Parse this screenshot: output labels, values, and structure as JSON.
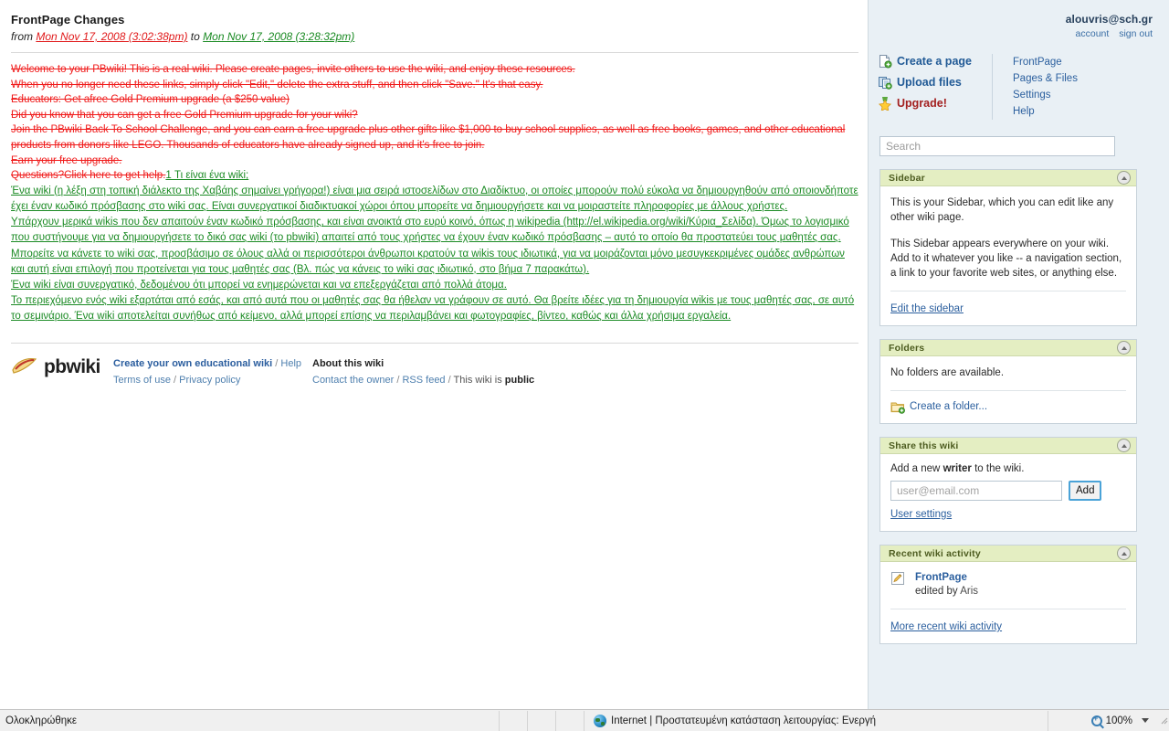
{
  "page": {
    "title": "FrontPage Changes",
    "revision": {
      "from_word": "from",
      "from_date": "Mon Nov 17, 2008 (3:02:38pm)",
      "to_word": "to",
      "to_date": "Mon Nov 17, 2008 (3:28:32pm)"
    }
  },
  "diff": {
    "deleted": [
      "Welcome to your PBwiki! This is a real wiki. Please create pages, invite others to use the wiki, and enjoy these resources.",
      "When you no longer need these links, simply click \"Edit,\" delete the extra stuff, and then click \"Save.\" It's that easy.",
      "Educators: Get afree Gold Premium upgrade (a $250 value)",
      "Did you know that you can get a free Gold Premium upgrade for your wiki?",
      "Join the PBwiki Back To School Challenge, and you can earn a free upgrade plus other gifts like $1,000 to buy school supplies, as well as free books, games, and other educational products from donors like LEGO. Thousands of educators have already signed up, and it's free to join.",
      "Earn your free upgrade."
    ],
    "mixed_line": {
      "deleted": "Questions?Click here to get help.",
      "inserted": "1 Τι είναι ένα wiki;"
    },
    "inserted": [
      "Ένα wiki (η λέξη στη τοπική διάλεκτο της Χαβάης σημαίνει γρήγορα!) είναι μια σειρά ιστοσελίδων στο Διαδίκτυο, οι οποίες μπορούν πολύ εύκολα να δημιουργηθούν από οποιονδήποτε έχει έναν κωδικό πρόσβασης στο wiki σας. Είναι συνεργατικοί διαδικτυακοί χώροι όπου μπορείτε να δημιουργήσετε και να μοιραστείτε πληροφορίες με άλλους χρήστες.",
      "Υπάρχουν μερικά wikis που δεν απαιτούν έναν κωδικό πρόσβασης, και είναι ανοικτά στο ευρύ κοινό, όπως η wikipedia (http://el.wikipedia.org/wiki/Κύρια_Σελίδα). Όμως το λογισμικό που συστήνουμε για να δημιουργήσετε το δικό σας wiki (το pbwiki) απαιτεί από τους χρήστες να έχουν έναν κωδικό πρόσβασης – αυτό το οποίο θα προστατεύει τους μαθητές σας. Μπορείτε να κάνετε το wiki σας, προσβάσιμο σε όλους αλλά οι περισσότεροι άνθρωποι κρατούν τα wikis τους ιδιωτικά, για να μοιράζονται μόνο μεσυγκεκριμένες ομάδες ανθρώπων και αυτή είναι επιλογή που προτείνεται για τους μαθητές σας (Βλ. πώς να κάνεις το wiki σας ιδιωτικό, στο βήμα 7 παρακάτω).",
      "Ένα wiki είναι συνεργατικό, δεδομένου ότι μπορεί να ενημερώνεται και να επεξεργάζεται από πολλά άτομα.",
      "Το περιεχόμενο ενός wiki εξαρτάται από εσάς, και από αυτά που οι μαθητές σας θα ήθελαν να γράφουν σε αυτό. Θα βρείτε ιδέες για τη δημιουργία wikis με τους μαθητές σας, σε αυτό το σεμινάριο. Ένα wiki αποτελείται συνήθως από κείμενο, αλλά μπορεί επίσης να περιλαμβάνει και φωτογραφίες, βίντεο, καθώς και άλλα χρήσιμα εργαλεία."
    ]
  },
  "footer": {
    "logo_text": "pbwiki",
    "create_link": "Create your own educational wiki",
    "help_link": "Help",
    "terms_link": "Terms of use",
    "privacy_link": "Privacy policy",
    "about_title": "About this wiki",
    "contact_link": "Contact the owner",
    "rss_link": "RSS feed",
    "visibility_prefix": "This wiki is",
    "visibility_value": "public",
    "slash": "/"
  },
  "account": {
    "email": "alouvris@sch.gr",
    "account_link": "account",
    "signout_link": "sign out"
  },
  "quicknav": {
    "actions": [
      {
        "label": "Create a page",
        "icon": "new-page-icon"
      },
      {
        "label": "Upload files",
        "icon": "upload-icon"
      },
      {
        "label": "Upgrade!",
        "icon": "star-icon"
      }
    ],
    "links": [
      "FrontPage",
      "Pages & Files",
      "Settings",
      "Help"
    ]
  },
  "search": {
    "placeholder": "Search",
    "value": ""
  },
  "panels": {
    "sidebar": {
      "title": "Sidebar",
      "paragraph1": "This is your Sidebar, which you can edit like any other wiki page.",
      "paragraph2": "This Sidebar appears everywhere on your wiki. Add to it whatever you like -- a navigation section, a link to your favorite web sites, or anything else.",
      "edit_link": "Edit the sidebar"
    },
    "folders": {
      "title": "Folders",
      "empty_text": "No folders are available.",
      "create_link": "Create a folder..."
    },
    "share": {
      "title": "Share this wiki",
      "label_prefix": "Add a new",
      "label_role": "writer",
      "label_suffix": "to the wiki.",
      "email_placeholder": "user@email.com",
      "email_value": "",
      "add_button": "Add",
      "user_settings_link": "User settings"
    },
    "activity": {
      "title": "Recent wiki activity",
      "page_name": "FrontPage",
      "edited_prefix": "edited by",
      "edited_by": "Aris",
      "more_link": "More recent wiki activity"
    }
  },
  "statusbar": {
    "status_text": "Ολοκληρώθηκε",
    "zone_text": "Internet | Προστατευμένη κατάσταση λειτουργίας: Ενεργή",
    "zoom_level": "100%"
  },
  "colors": {
    "deleted": "#f01b1b",
    "inserted": "#1a8a23",
    "panel_header": "#e4eec2",
    "rail_background": "#e9f0f5",
    "link": "#2b5f9e"
  }
}
